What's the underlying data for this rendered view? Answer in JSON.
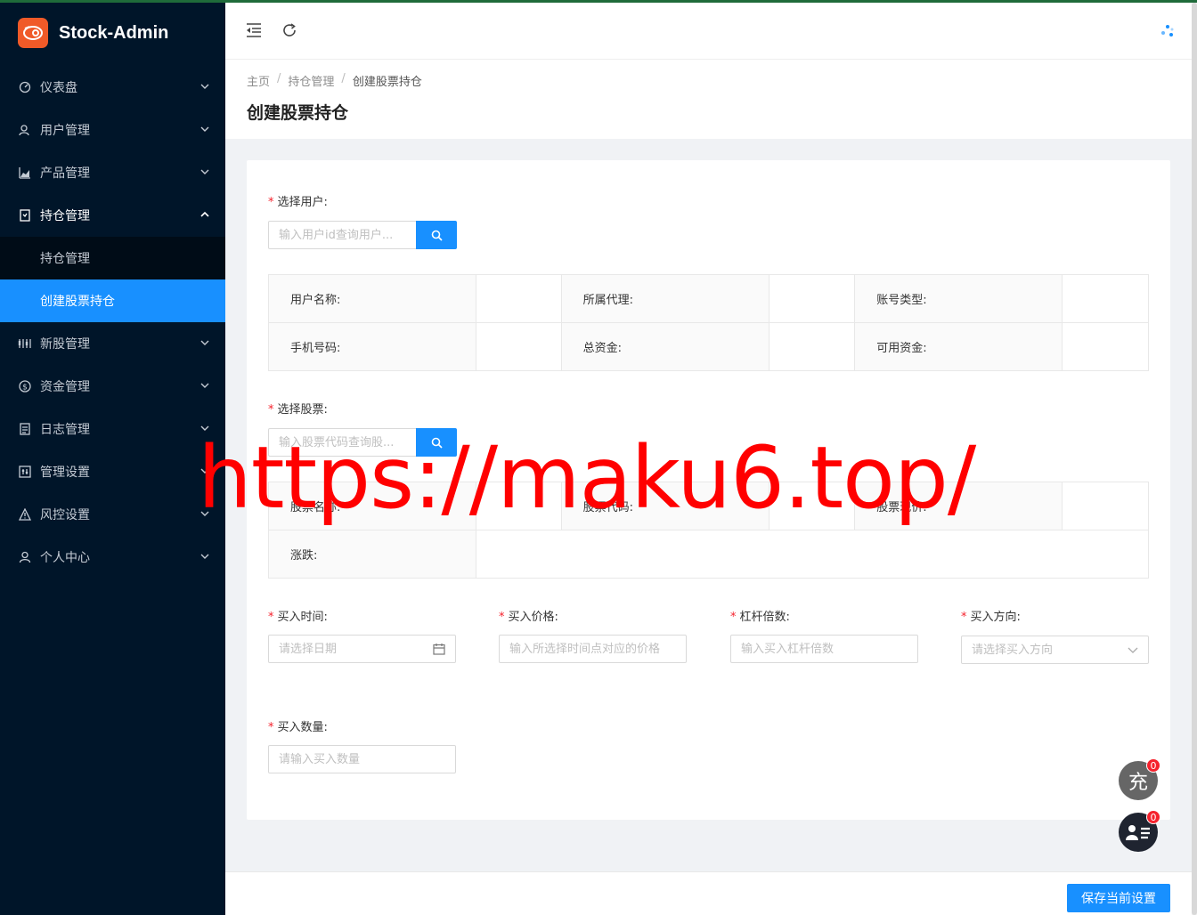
{
  "app": {
    "name": "Stock-Admin"
  },
  "sidebar": {
    "items": [
      {
        "label": "仪表盘",
        "icon": "dashboard-icon"
      },
      {
        "label": "用户管理",
        "icon": "users-icon"
      },
      {
        "label": "产品管理",
        "icon": "area-chart-icon"
      },
      {
        "label": "持仓管理",
        "icon": "position-icon",
        "open": true,
        "children": [
          {
            "label": "持仓管理"
          },
          {
            "label": "创建股票持仓",
            "active": true
          }
        ]
      },
      {
        "label": "新股管理",
        "icon": "ipo-icon"
      },
      {
        "label": "资金管理",
        "icon": "money-icon"
      },
      {
        "label": "日志管理",
        "icon": "log-icon"
      },
      {
        "label": "管理设置",
        "icon": "settings-icon"
      },
      {
        "label": "风控设置",
        "icon": "warning-icon"
      },
      {
        "label": "个人中心",
        "icon": "user-icon"
      }
    ]
  },
  "breadcrumb": [
    "主页",
    "持仓管理",
    "创建股票持仓"
  ],
  "page": {
    "title": "创建股票持仓"
  },
  "form": {
    "user_label": "选择用户:",
    "user_search_placeholder": "输入用户id查询用户...",
    "user_info": {
      "row1": [
        "用户名称:",
        "所属代理:",
        "账号类型:"
      ],
      "row2": [
        "手机号码:",
        "总资金:",
        "可用资金:"
      ]
    },
    "stock_label": "选择股票:",
    "stock_search_placeholder": "输入股票代码查询股...",
    "stock_info": {
      "row1": [
        "股票名称:",
        "股票代码:",
        "股票现价:"
      ],
      "row2": [
        "涨跌:"
      ]
    },
    "buy_time": {
      "label": "买入时间:",
      "placeholder": "请选择日期"
    },
    "buy_price": {
      "label": "买入价格:",
      "placeholder": "输入所选择时间点对应的价格"
    },
    "leverage": {
      "label": "杠杆倍数:",
      "placeholder": "输入买入杠杆倍数"
    },
    "direction": {
      "label": "买入方向:",
      "placeholder": "请选择买入方向"
    },
    "quantity": {
      "label": "买入数量:",
      "placeholder": "请输入买入数量"
    }
  },
  "footer": {
    "save_label": "保存当前设置"
  },
  "floats": {
    "recharge": {
      "label": "充",
      "badge": "0"
    },
    "list": {
      "badge": "0"
    }
  },
  "watermark": "https://maku6.top/",
  "colors": {
    "sidebar_bg": "#001529",
    "primary": "#1890ff",
    "logo": "#f05a28",
    "required": "#f5222d"
  }
}
